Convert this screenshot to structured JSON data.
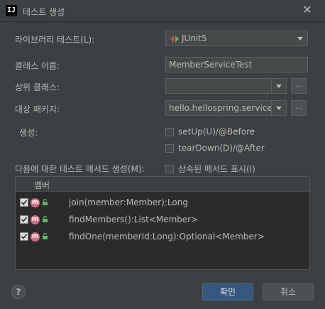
{
  "window": {
    "title": "테스트 생성",
    "icon_text": "IJ",
    "close": "✕"
  },
  "library": {
    "label": "라이브러리 테스트(L):",
    "value": "JUnit5"
  },
  "class_name": {
    "label": "클래스 이름:",
    "value": "MemberServiceTest"
  },
  "superclass": {
    "label": "상위 클래스:",
    "value": "",
    "browse": "..."
  },
  "package": {
    "label": "대상 패키지:",
    "value": "hello.hellospring.service",
    "browse": "..."
  },
  "generate": {
    "label": "생성:",
    "options": [
      {
        "label": "setUp(U)/@Before",
        "checked": false
      },
      {
        "label": "tearDown(D)/@After",
        "checked": false
      }
    ]
  },
  "methods": {
    "label": "다음에 대한 테스트 메서드 생성(M):",
    "show_inherited": {
      "label": "상속된 메서드 표시(I)",
      "checked": false
    },
    "column_header": "멤버",
    "items": [
      {
        "signature": "join(member:Member):Long",
        "checked": true,
        "icon": "m"
      },
      {
        "signature": "findMembers():List<Member>",
        "checked": true,
        "icon": "m"
      },
      {
        "signature": "findOne(memberId:Long):Optional<Member>",
        "checked": true,
        "icon": "m"
      }
    ]
  },
  "footer": {
    "help": "?",
    "ok": "확인",
    "cancel": "취소"
  },
  "colors": {
    "background": "#3c3f41",
    "accent": "#365880",
    "method_icon": "#d36e81"
  }
}
